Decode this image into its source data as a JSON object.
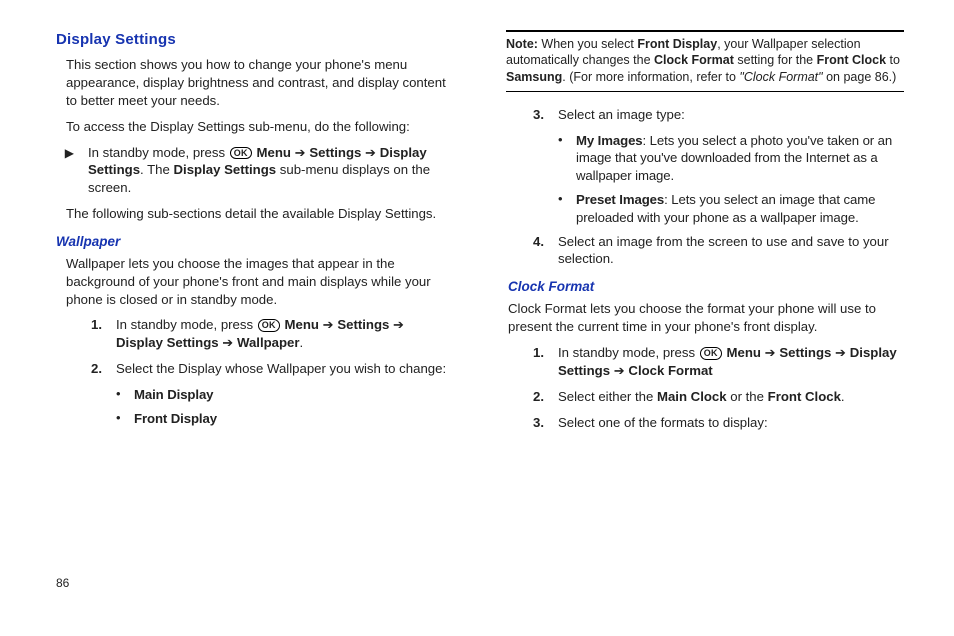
{
  "page_number": "86",
  "left": {
    "title": "Display Settings",
    "p1": "This section shows you how to change your phone's menu appearance, display brightness and contrast, and display content to better meet your needs.",
    "p2": "To access the Display Settings sub-menu, do the following:",
    "standby_prefix": "In standby mode, press ",
    "ok_label": "OK",
    "menu_word": "Menu",
    "arrow": " ➔ ",
    "settings_word": "Settings",
    "display_settings": "Display Settings",
    "standby_suffix": ". The ",
    "standby_tail": " sub-menu displays on the screen.",
    "p3": "The following sub-sections detail the available Display Settings.",
    "sub_title": "Wallpaper",
    "wp_p1": "Wallpaper lets you choose the images that appear in the background of your phone's front and main displays while your phone is closed or in standby mode.",
    "s1_num": "1.",
    "s1_pre": "In standby mode, press ",
    "s1_display": "Display Settings ",
    "s1_wall": "Wallpaper",
    "s1_tail": ".",
    "s2_num": "2.",
    "s2_text": "Select the Display whose Wallpaper you wish to change:",
    "b1": "Main Display",
    "b2": "Front Display"
  },
  "right": {
    "note_label": "Note:",
    "note_a": " When you select ",
    "note_fd": "Front Display",
    "note_b": ", your Wallpaper selection automatically changes the ",
    "note_cf": "Clock Format",
    "note_c": " setting for the ",
    "note_fc": "Front Clock",
    "note_d": " to ",
    "note_s": "Samsung",
    "note_e": ". (For more information, refer to ",
    "note_ref": "\"Clock Format\"",
    "note_f": "  on page 86.)",
    "s3_num": "3.",
    "s3_text": "Select an image type:",
    "b1_label": "My Images",
    "b1_text": ": Lets you select a photo you've taken or an image that you've downloaded from the Internet as a wallpaper image.",
    "b2_label": "Preset Images",
    "b2_text": ": Lets you select an image that came preloaded with your phone as a wallpaper image.",
    "s4_num": "4.",
    "s4_text": "Select an image from the screen to use and save to your selection.",
    "sub_title": "Clock Format",
    "cf_p1": "Clock Format lets you choose the format your phone will use to present the current time in your phone's front display.",
    "cs1_num": "1.",
    "cs1_pre": "In standby mode, press ",
    "cs1_ds": "Display Settings",
    "cs1_cf": "Clock Format",
    "cs2_num": "2.",
    "cs2_a": "Select either the ",
    "cs2_mc": "Main Clock",
    "cs2_b": " or the ",
    "cs2_fc": "Front Clock",
    "cs2_c": ".",
    "cs3_num": "3.",
    "cs3_text": "Select one of the formats to display:"
  }
}
